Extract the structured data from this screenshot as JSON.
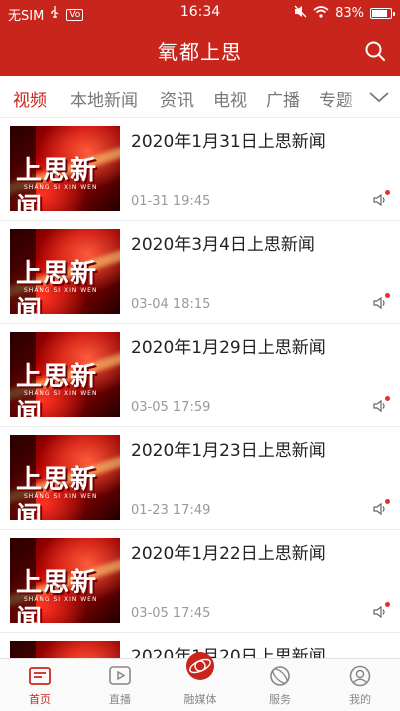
{
  "status_bar": {
    "carrier": "无SIM",
    "time": "16:34",
    "sim_badge": "Vo",
    "battery": "83%",
    "battery_level": 0.83
  },
  "header": {
    "title": "氧都上思"
  },
  "tabs": [
    {
      "label": "视频",
      "active": true
    },
    {
      "label": "本地新闻",
      "active": false
    },
    {
      "label": "资讯",
      "active": false
    },
    {
      "label": "电视",
      "active": false
    },
    {
      "label": "广播",
      "active": false
    },
    {
      "label": "专题",
      "active": false
    }
  ],
  "thumbnail": {
    "logo_text": "上思新闻",
    "sub_text": "SHANG SI XIN WEN"
  },
  "news": [
    {
      "title": "2020年1月31日上思新闻",
      "time": "01-31 19:45"
    },
    {
      "title": "2020年3月4日上思新闻",
      "time": "03-04 18:15"
    },
    {
      "title": "2020年1月29日上思新闻",
      "time": "03-05 17:59"
    },
    {
      "title": "2020年1月23日上思新闻",
      "time": "01-23 17:49"
    },
    {
      "title": "2020年1月22日上思新闻",
      "time": "03-05 17:45"
    },
    {
      "title": "2020年1月20日上思新闻",
      "time": ""
    }
  ],
  "bottom_nav": [
    {
      "label": "首页",
      "icon": "home-icon",
      "active": true
    },
    {
      "label": "直播",
      "icon": "play-icon",
      "active": false
    },
    {
      "label": "融媒体",
      "icon": "media-globe-icon",
      "active": false
    },
    {
      "label": "服务",
      "icon": "service-icon",
      "active": false
    },
    {
      "label": "我的",
      "icon": "user-icon",
      "active": false
    }
  ],
  "colors": {
    "accent": "#c8261d",
    "inactive": "#888888"
  }
}
